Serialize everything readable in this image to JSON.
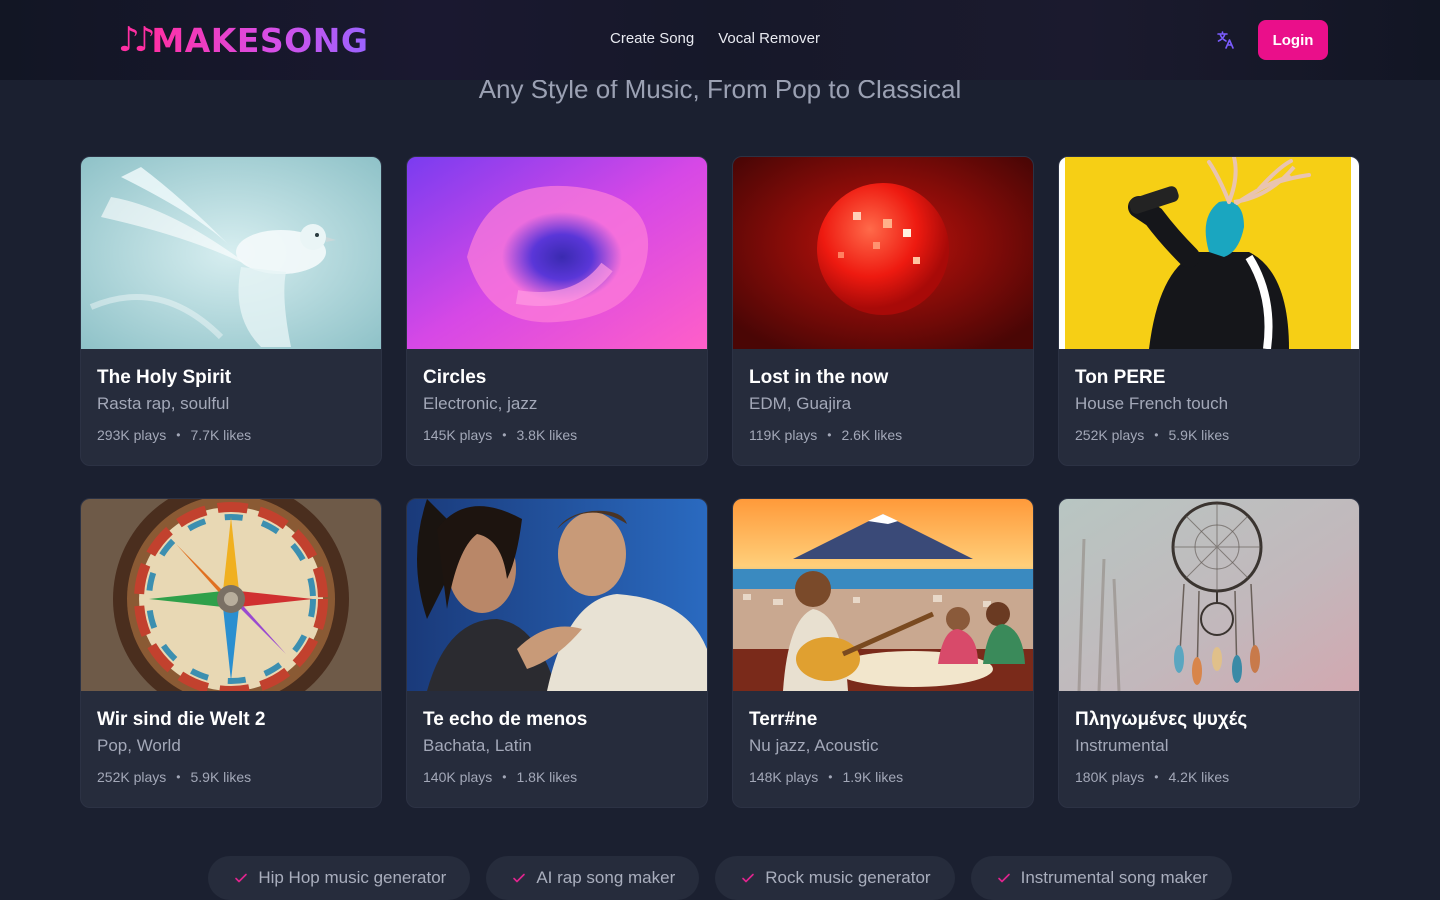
{
  "header": {
    "logo_notes": "♪♪",
    "logo_text": "MAKESONG",
    "nav": [
      "Create Song",
      "Vocal Remover"
    ],
    "login_label": "Login",
    "translate_icon": "translate-icon"
  },
  "subtitle": "Any Style of Music, From Pop to Classical",
  "songs": [
    {
      "title": "The Holy Spirit",
      "genre": "Rasta rap, soulful",
      "plays": "293K plays",
      "likes": "7.7K likes"
    },
    {
      "title": "Circles",
      "genre": "Electronic, jazz",
      "plays": "145K plays",
      "likes": "3.8K likes"
    },
    {
      "title": "Lost in the now",
      "genre": "EDM, Guajira",
      "plays": "119K plays",
      "likes": "2.6K likes"
    },
    {
      "title": "Ton PERE",
      "genre": "House French touch",
      "plays": "252K plays",
      "likes": "5.9K likes"
    },
    {
      "title": "Wir sind die Welt 2",
      "genre": "Pop, World",
      "plays": "252K plays",
      "likes": "5.9K likes"
    },
    {
      "title": "Te echo de menos",
      "genre": "Bachata, Latin",
      "plays": "140K plays",
      "likes": "1.8K likes"
    },
    {
      "title": "Terr#ne",
      "genre": "Nu jazz, Acoustic",
      "plays": "148K plays",
      "likes": "1.9K likes"
    },
    {
      "title": "Πληγωμένες ψυχές",
      "genre": "Instrumental",
      "plays": "180K plays",
      "likes": "4.2K likes"
    }
  ],
  "chips": [
    "Hip Hop music generator",
    "AI rap song maker",
    "Rock music generator",
    "Instrumental song maker"
  ],
  "colors": {
    "accent": "#ea0f8a",
    "background": "#1b2030",
    "card": "#262c3c"
  }
}
